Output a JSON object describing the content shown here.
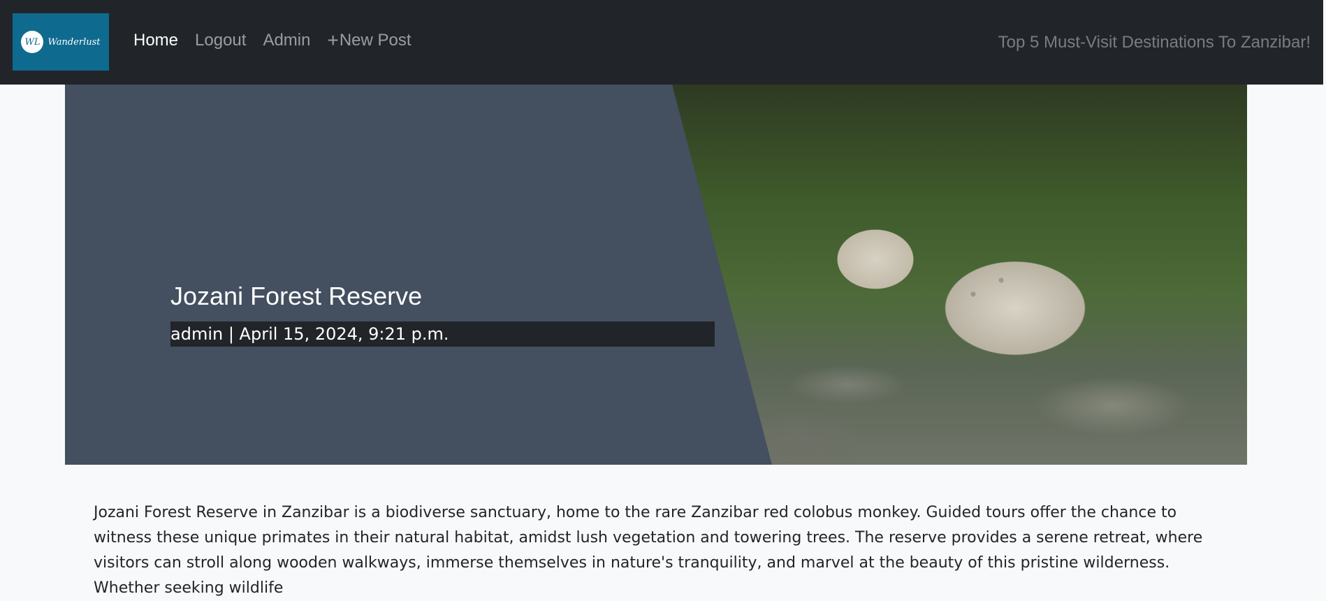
{
  "nav": {
    "logo_mark": "WL",
    "logo_text": "Wanderlust",
    "links": [
      {
        "label": "Home"
      },
      {
        "label": "Logout"
      },
      {
        "label": "Admin"
      },
      {
        "label": "New Post",
        "icon": "plus-icon"
      }
    ],
    "right_text": "Top 5 Must-Visit Destinations To Zanzibar!"
  },
  "hero": {
    "title": "Jozani Forest Reserve",
    "meta": "admin | April 15, 2024, 9:21 p.m."
  },
  "content": {
    "body": "Jozani Forest Reserve in Zanzibar is a biodiverse sanctuary, home to the rare Zanzibar red colobus monkey. Guided tours offer the chance to witness these unique primates in their natural habitat, amidst lush vegetation and towering trees. The reserve provides a serene retreat, where visitors can stroll along wooden walkways, immerse themselves in nature's tranquility, and marvel at the beauty of this pristine wilderness. Whether seeking wildlife"
  },
  "colors": {
    "navbar_bg": "#212529",
    "logo_bg": "#0f6a8f",
    "hero_bg": "#444f5f",
    "meta_bg": "#212529",
    "page_bg": "#f8f9fa"
  }
}
